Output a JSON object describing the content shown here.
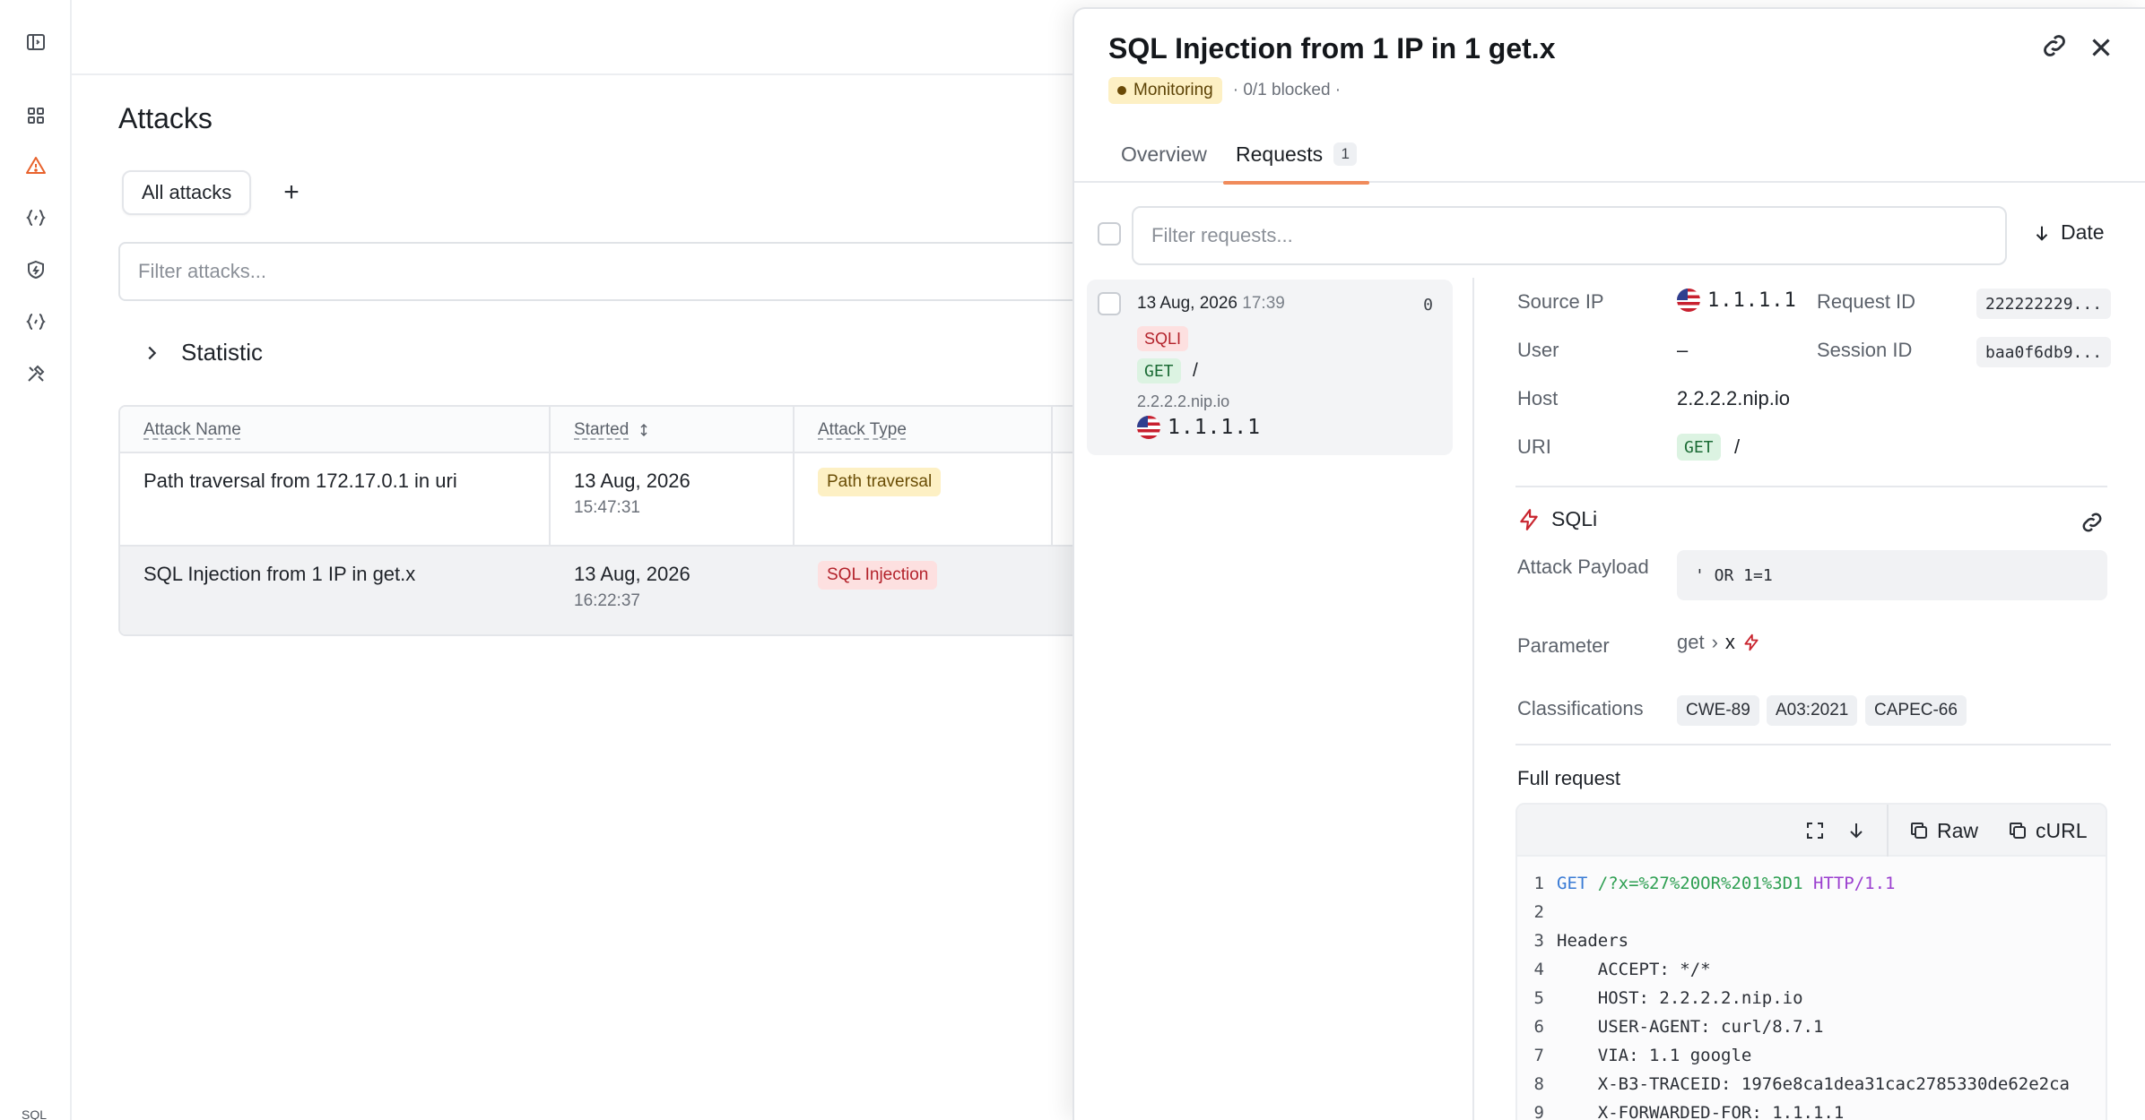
{
  "sidebar": {
    "items": [
      {
        "icon": "panel-toggle-icon"
      },
      {
        "icon": "dashboard-grid-icon"
      },
      {
        "icon": "warning-triangle-icon",
        "active_color": "#e8622c"
      },
      {
        "icon": "api-braces-icon"
      },
      {
        "icon": "shield-icon"
      },
      {
        "icon": "api-braces-icon"
      },
      {
        "icon": "tools-icon"
      }
    ],
    "footer_text": "SQL"
  },
  "main": {
    "title": "Attacks",
    "tabs": [
      {
        "label": "All attacks"
      }
    ],
    "add_tab_label": "+",
    "filter_placeholder": "Filter attacks...",
    "statistic_label": "Statistic",
    "table": {
      "columns": [
        "Attack Name",
        "Started",
        "Attack Type"
      ],
      "rows": [
        {
          "name": "Path traversal from 172.17.0.1 in uri",
          "date": "13 Aug, 2026",
          "time": "15:47:31",
          "type": "Path traversal"
        },
        {
          "name": "SQL Injection from 1 IP in get.x",
          "date": "13 Aug, 2026",
          "time": "16:22:37",
          "type": "SQL Injection"
        }
      ]
    }
  },
  "drawer": {
    "title": "SQL Injection from 1 IP in 1 get.x",
    "status": "Monitoring",
    "blocked": "· 0/1 blocked ·",
    "tabs": [
      {
        "label": "Overview"
      },
      {
        "label": "Requests",
        "count": "1"
      }
    ],
    "filter_placeholder": "Filter requests...",
    "sort_label": "Date",
    "request": {
      "date": "13 Aug, 2026",
      "time": "17:39",
      "count": "0",
      "tag": "SQLI",
      "method": "GET",
      "path": "/",
      "host": "2.2.2.2.nip.io",
      "ip": "1.1.1.1"
    },
    "details": {
      "source_ip_label": "Source IP",
      "source_ip": "1.1.1.1",
      "request_id_label": "Request ID",
      "request_id": "222222229...",
      "user_label": "User",
      "user": "–",
      "session_id_label": "Session ID",
      "session_id": "baa0f6db9...",
      "host_label": "Host",
      "host": "2.2.2.2.nip.io",
      "uri_label": "URI",
      "uri_method": "GET",
      "uri_path": "/"
    },
    "attack": {
      "name": "SQLi",
      "payload_label": "Attack Payload",
      "payload": "' OR 1=1",
      "parameter_label": "Parameter",
      "parameter_root": "get",
      "parameter_sep": "›",
      "parameter_key": "x",
      "classifications_label": "Classifications",
      "classifications": [
        "CWE-89",
        "A03:2021",
        "CAPEC-66"
      ]
    },
    "full_request": {
      "label": "Full request",
      "raw_label": "Raw",
      "curl_label": "cURL",
      "lines": [
        {
          "n": "1",
          "method": "GET",
          "url": " /?x=%27%20OR%201%3D1",
          "proto": " HTTP/1.1"
        },
        {
          "n": "2",
          "text": ""
        },
        {
          "n": "3",
          "text": "Headers"
        },
        {
          "n": "4",
          "text": "    ACCEPT: */*"
        },
        {
          "n": "5",
          "text": "    HOST: 2.2.2.2.nip.io"
        },
        {
          "n": "6",
          "text": "    USER-AGENT: curl/8.7.1"
        },
        {
          "n": "7",
          "text": "    VIA: 1.1 google"
        },
        {
          "n": "8",
          "text": "    X-B3-TRACEID: 1976e8ca1dea31cac2785330de62e2ca"
        },
        {
          "n": "9",
          "text": "    X-FORWARDED-FOR: 1.1.1.1"
        }
      ]
    }
  },
  "colors": {
    "accent": "#f08b5b",
    "danger": "#b3222b",
    "warning_bg": "#fdf0c4",
    "success_bg": "#dcf3e2"
  }
}
